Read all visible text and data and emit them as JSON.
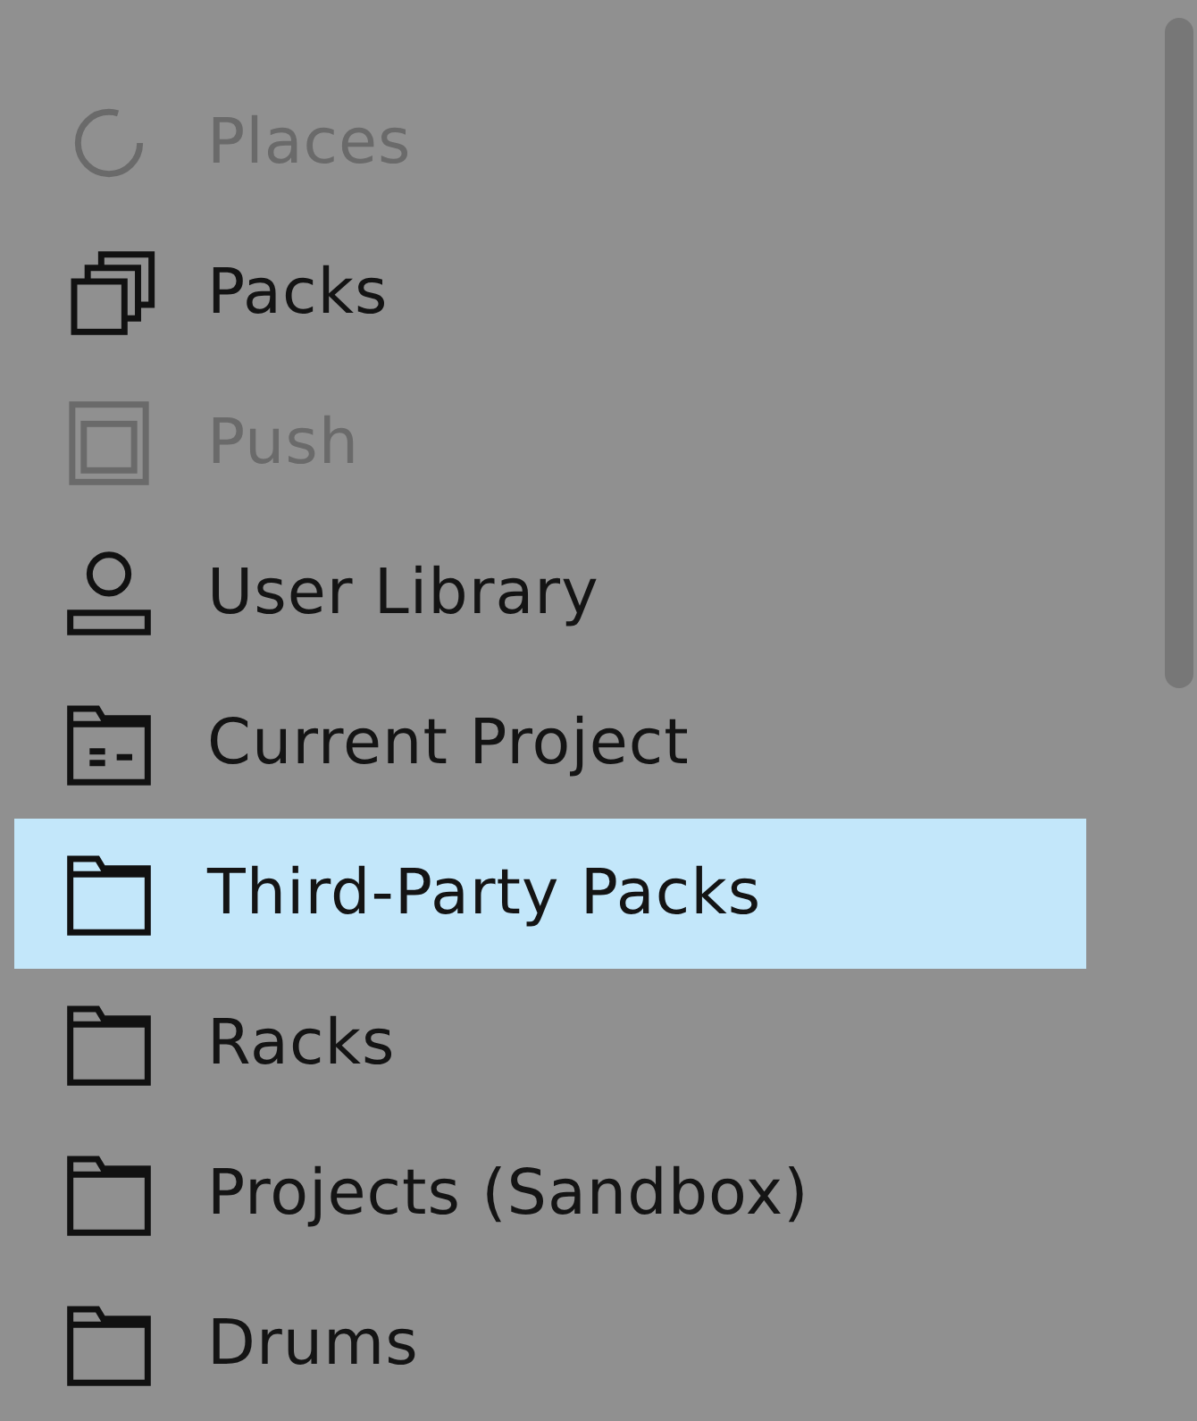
{
  "sidebar": {
    "items": [
      {
        "kind": "places",
        "label": "Places",
        "disabled": true,
        "selected": false
      },
      {
        "kind": "packs",
        "label": "Packs",
        "disabled": false,
        "selected": false
      },
      {
        "kind": "push",
        "label": "Push",
        "disabled": true,
        "selected": false
      },
      {
        "kind": "user",
        "label": "User Library",
        "disabled": false,
        "selected": false
      },
      {
        "kind": "project",
        "label": "Current Project",
        "disabled": false,
        "selected": false
      },
      {
        "kind": "folder",
        "label": "Third-Party Packs",
        "disabled": false,
        "selected": true
      },
      {
        "kind": "folder",
        "label": "Racks",
        "disabled": false,
        "selected": false
      },
      {
        "kind": "folder",
        "label": "Projects (Sandbox)",
        "disabled": false,
        "selected": false
      },
      {
        "kind": "folder",
        "label": "Drums",
        "disabled": false,
        "selected": false
      }
    ]
  }
}
